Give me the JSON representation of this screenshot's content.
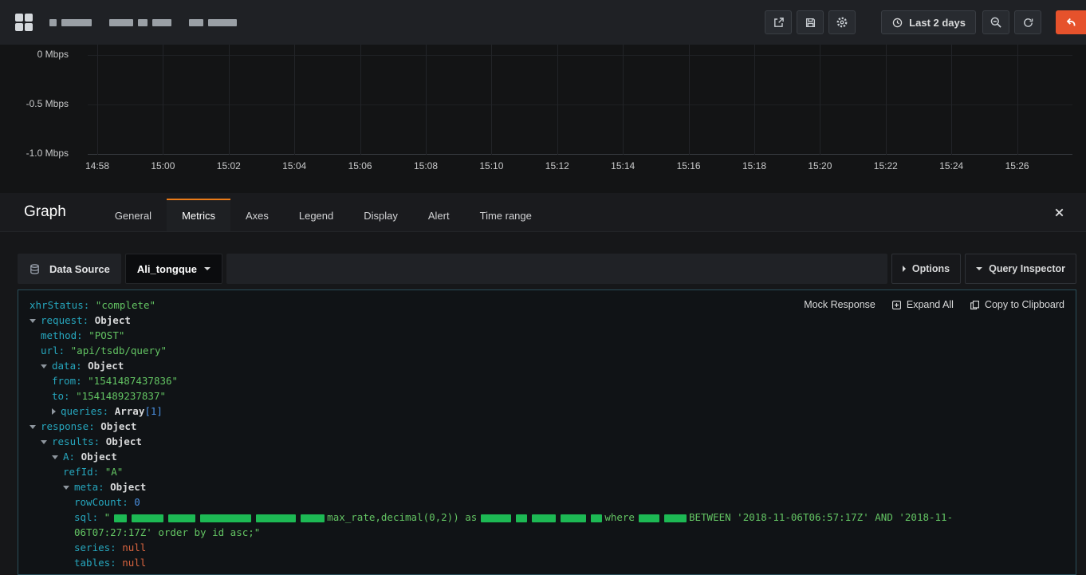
{
  "colors": {
    "nav_bg": "#1f2125",
    "page_bg": "#161719",
    "chart_bg": "#131415",
    "accent_orange": "#eb7b18",
    "back_button_bg": "#e6522c",
    "json_key": "#26a6bd",
    "json_string": "#63c463",
    "json_number": "#4a8fe0",
    "json_null": "#d9643f",
    "redact_green": "#1db954",
    "redact_gray": "#9aa0a6"
  },
  "topnav": {
    "logo_icon": "grafana-logo",
    "redacted_groups": [
      [
        9,
        38
      ],
      [
        30,
        12,
        24
      ],
      [
        18,
        36
      ]
    ],
    "icon_buttons": [
      {
        "name": "share",
        "icon": "share-icon"
      },
      {
        "name": "save",
        "icon": "save-icon"
      },
      {
        "name": "settings",
        "icon": "gear-icon"
      }
    ],
    "time_range_label": "Last 2 days",
    "time_range_icon": "clock-icon",
    "zoom_out_icon": "zoom-out-icon",
    "refresh_icon": "refresh-icon",
    "back_icon": "back-arrow-icon"
  },
  "chart_data": {
    "type": "line",
    "title": "",
    "xlabel": "",
    "ylabel": "",
    "grid": true,
    "legend": false,
    "x_ticks": [
      "14:58",
      "15:00",
      "15:02",
      "15:04",
      "15:06",
      "15:08",
      "15:10",
      "15:12",
      "15:14",
      "15:16",
      "15:18",
      "15:20",
      "15:22",
      "15:24",
      "15:26"
    ],
    "y_ticks": [
      {
        "label": "0 Mbps",
        "value": 0
      },
      {
        "label": "-0.5 Mbps",
        "value": -0.5
      },
      {
        "label": "-1.0 Mbps",
        "value": -1.0
      }
    ],
    "ylim": [
      -1.0,
      0
    ],
    "series": []
  },
  "editor": {
    "panel_type": "Graph",
    "tabs": [
      "General",
      "Metrics",
      "Axes",
      "Legend",
      "Display",
      "Alert",
      "Time range"
    ],
    "active_tab": "Metrics",
    "close_icon": "close-icon"
  },
  "query_bar": {
    "datasource_icon": "database-icon",
    "datasource_label": "Data Source",
    "datasource_value": "Ali_tongque",
    "options_label": "Options",
    "query_inspector_label": "Query Inspector"
  },
  "inspector": {
    "actions": {
      "mock_response": "Mock Response",
      "expand_all": "Expand All",
      "copy_to_clipboard": "Copy to Clipboard"
    },
    "rows": [
      {
        "indent": 0,
        "arrow": null,
        "key": "xhrStatus",
        "segments": [
          {
            "t": "str",
            "v": "\"complete\""
          }
        ]
      },
      {
        "indent": 0,
        "arrow": "down",
        "key": "request",
        "segments": [
          {
            "t": "plain",
            "v": "Object"
          }
        ]
      },
      {
        "indent": 1,
        "arrow": null,
        "key": "method",
        "segments": [
          {
            "t": "str",
            "v": "\"POST\""
          }
        ]
      },
      {
        "indent": 1,
        "arrow": null,
        "key": "url",
        "segments": [
          {
            "t": "str",
            "v": "\"api/tsdb/query\""
          }
        ]
      },
      {
        "indent": 1,
        "arrow": "down",
        "key": "data",
        "segments": [
          {
            "t": "plain",
            "v": "Object"
          }
        ]
      },
      {
        "indent": 2,
        "arrow": null,
        "key": "from",
        "segments": [
          {
            "t": "str",
            "v": "\"1541487437836\""
          }
        ]
      },
      {
        "indent": 2,
        "arrow": null,
        "key": "to",
        "segments": [
          {
            "t": "str",
            "v": "\"1541489237837\""
          }
        ]
      },
      {
        "indent": 2,
        "arrow": "right",
        "key": "queries",
        "segments": [
          {
            "t": "plain",
            "v": "Array"
          },
          {
            "t": "num",
            "v": "[1]"
          }
        ]
      },
      {
        "indent": 0,
        "arrow": "down",
        "key": "response",
        "segments": [
          {
            "t": "plain",
            "v": "Object"
          }
        ]
      },
      {
        "indent": 1,
        "arrow": "down",
        "key": "results",
        "segments": [
          {
            "t": "plain",
            "v": "Object"
          }
        ]
      },
      {
        "indent": 2,
        "arrow": "down",
        "key": "A",
        "segments": [
          {
            "t": "plain",
            "v": "Object"
          }
        ]
      },
      {
        "indent": 3,
        "arrow": null,
        "key": "refId",
        "segments": [
          {
            "t": "str",
            "v": "\"A\""
          }
        ]
      },
      {
        "indent": 3,
        "arrow": "down",
        "key": "meta",
        "segments": [
          {
            "t": "plain",
            "v": "Object"
          }
        ]
      },
      {
        "indent": 4,
        "arrow": null,
        "key": "rowCount",
        "segments": [
          {
            "t": "num",
            "v": "0"
          }
        ]
      },
      {
        "indent": 4,
        "arrow": null,
        "key": "sql",
        "segments": [
          {
            "t": "str",
            "v": "\""
          },
          {
            "t": "redact",
            "w": 16
          },
          {
            "t": "redact",
            "w": 40
          },
          {
            "t": "redact",
            "w": 34
          },
          {
            "t": "redact",
            "w": 64
          },
          {
            "t": "redact",
            "w": 50
          },
          {
            "t": "redact",
            "w": 30
          },
          {
            "t": "str",
            "v": "max_rate,decimal(0,2)) as"
          },
          {
            "t": "redact",
            "w": 38
          },
          {
            "t": "redact",
            "w": 14
          },
          {
            "t": "redact",
            "w": 30
          },
          {
            "t": "redact",
            "w": 32
          },
          {
            "t": "redact",
            "w": 14
          },
          {
            "t": "str",
            "v": "where"
          },
          {
            "t": "redact",
            "w": 26
          },
          {
            "t": "redact",
            "w": 28
          },
          {
            "t": "str",
            "v": "BETWEEN '2018-11-06T06:57:17Z' AND '2018-11-"
          },
          {
            "t": "break"
          },
          {
            "t": "str",
            "v": "06T07:27:17Z' order by id asc;\""
          }
        ]
      },
      {
        "indent": 4,
        "arrow": null,
        "key": "series",
        "segments": [
          {
            "t": "null",
            "v": "null"
          }
        ]
      },
      {
        "indent": 4,
        "arrow": null,
        "key": "tables",
        "segments": [
          {
            "t": "null",
            "v": "null"
          }
        ]
      }
    ]
  }
}
